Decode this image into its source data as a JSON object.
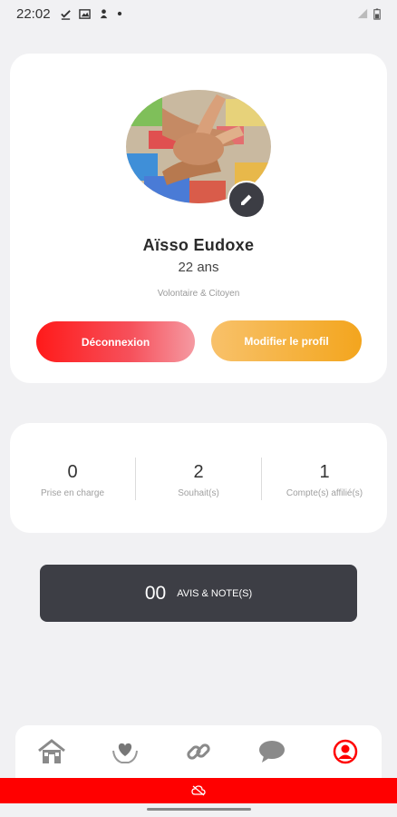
{
  "status_bar": {
    "time": "22:02",
    "left_icons": [
      "check-icon",
      "image-icon",
      "person-notification-icon",
      "dot-icon"
    ],
    "right_icons": [
      "signal-icon",
      "battery-icon"
    ]
  },
  "profile": {
    "name": "Aïsso Eudoxe",
    "age": "22 ans",
    "role": "Volontaire & Citoyen",
    "logout_label": "Déconnexion",
    "edit_profile_label": "Modifier le profil"
  },
  "stats": [
    {
      "value": "0",
      "label": "Prise en charge"
    },
    {
      "value": "2",
      "label": "Souhait(s)"
    },
    {
      "value": "1",
      "label": "Compte(s) affilié(s)"
    }
  ],
  "reviews": {
    "count": "00",
    "label": "AVIS & NOTE(S)"
  },
  "bottom_nav": [
    {
      "icon": "home-icon"
    },
    {
      "icon": "heart-hands-icon"
    },
    {
      "icon": "link-icon"
    },
    {
      "icon": "chat-icon"
    },
    {
      "icon": "profile-icon",
      "active": true
    }
  ],
  "colors": {
    "accent_red": "#ff0000",
    "logout_gradient_start": "#ff1a1a",
    "edit_gradient": "#f5b13c",
    "dark_bar": "#3d3e45"
  }
}
